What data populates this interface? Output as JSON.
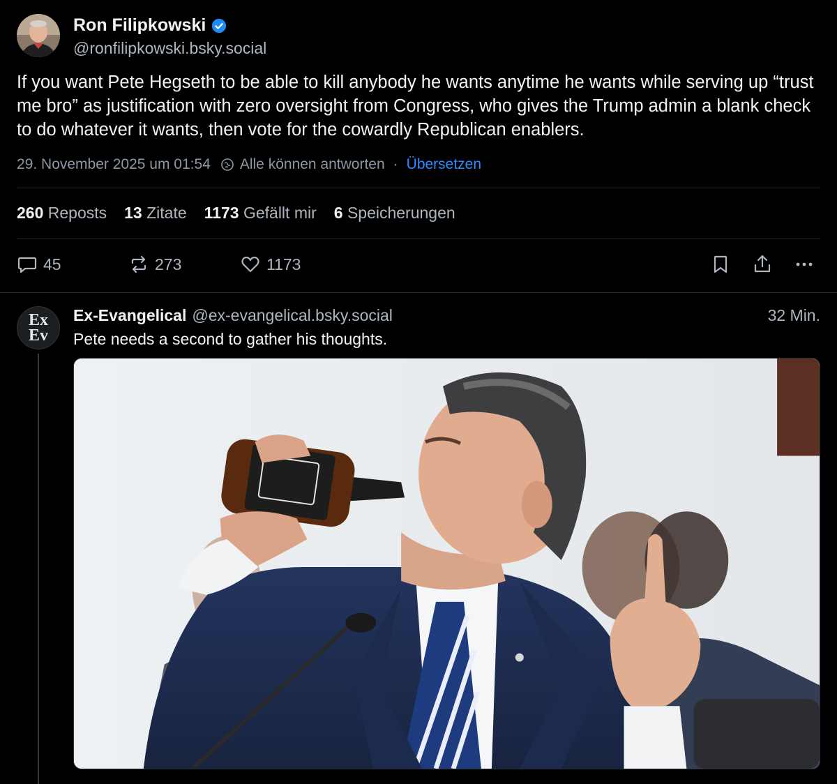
{
  "post": {
    "author": {
      "name": "Ron Filipkowski",
      "handle": "@ronfilipkowski.bsky.social",
      "verified": true
    },
    "text": "If you want Pete Hegseth to be able to kill anybody he wants anytime he wants while serving up “trust me bro” as justification with zero oversight from Congress, who gives the Trump admin a blank check to do whatever it wants, then vote for the cowardly Republican enablers.",
    "timestamp": "29. November 2025 um 01:54",
    "reply_setting": "Alle können antworten",
    "separator": "·",
    "translate_label": "Übersetzen",
    "stats": {
      "reposts_count": "260",
      "reposts_label": "Reposts",
      "quotes_count": "13",
      "quotes_label": "Zitate",
      "likes_count": "1173",
      "likes_label": "Gefällt mir",
      "saves_count": "6",
      "saves_label": "Speicherungen"
    },
    "actions": {
      "replies": "45",
      "reposts": "273",
      "likes": "1173"
    }
  },
  "reply": {
    "author": {
      "name": "Ex-Evangelical",
      "handle": "@ex-evangelical.bsky.social",
      "avatar_text_1": "Ex",
      "avatar_text_2": "Ev"
    },
    "time": "32 Min.",
    "text": "Pete needs a second to gather his thoughts."
  },
  "colors": {
    "background": "#000000",
    "link": "#2f8cff",
    "muted": "#aeb6bf",
    "verified": "#1d8cf8"
  }
}
